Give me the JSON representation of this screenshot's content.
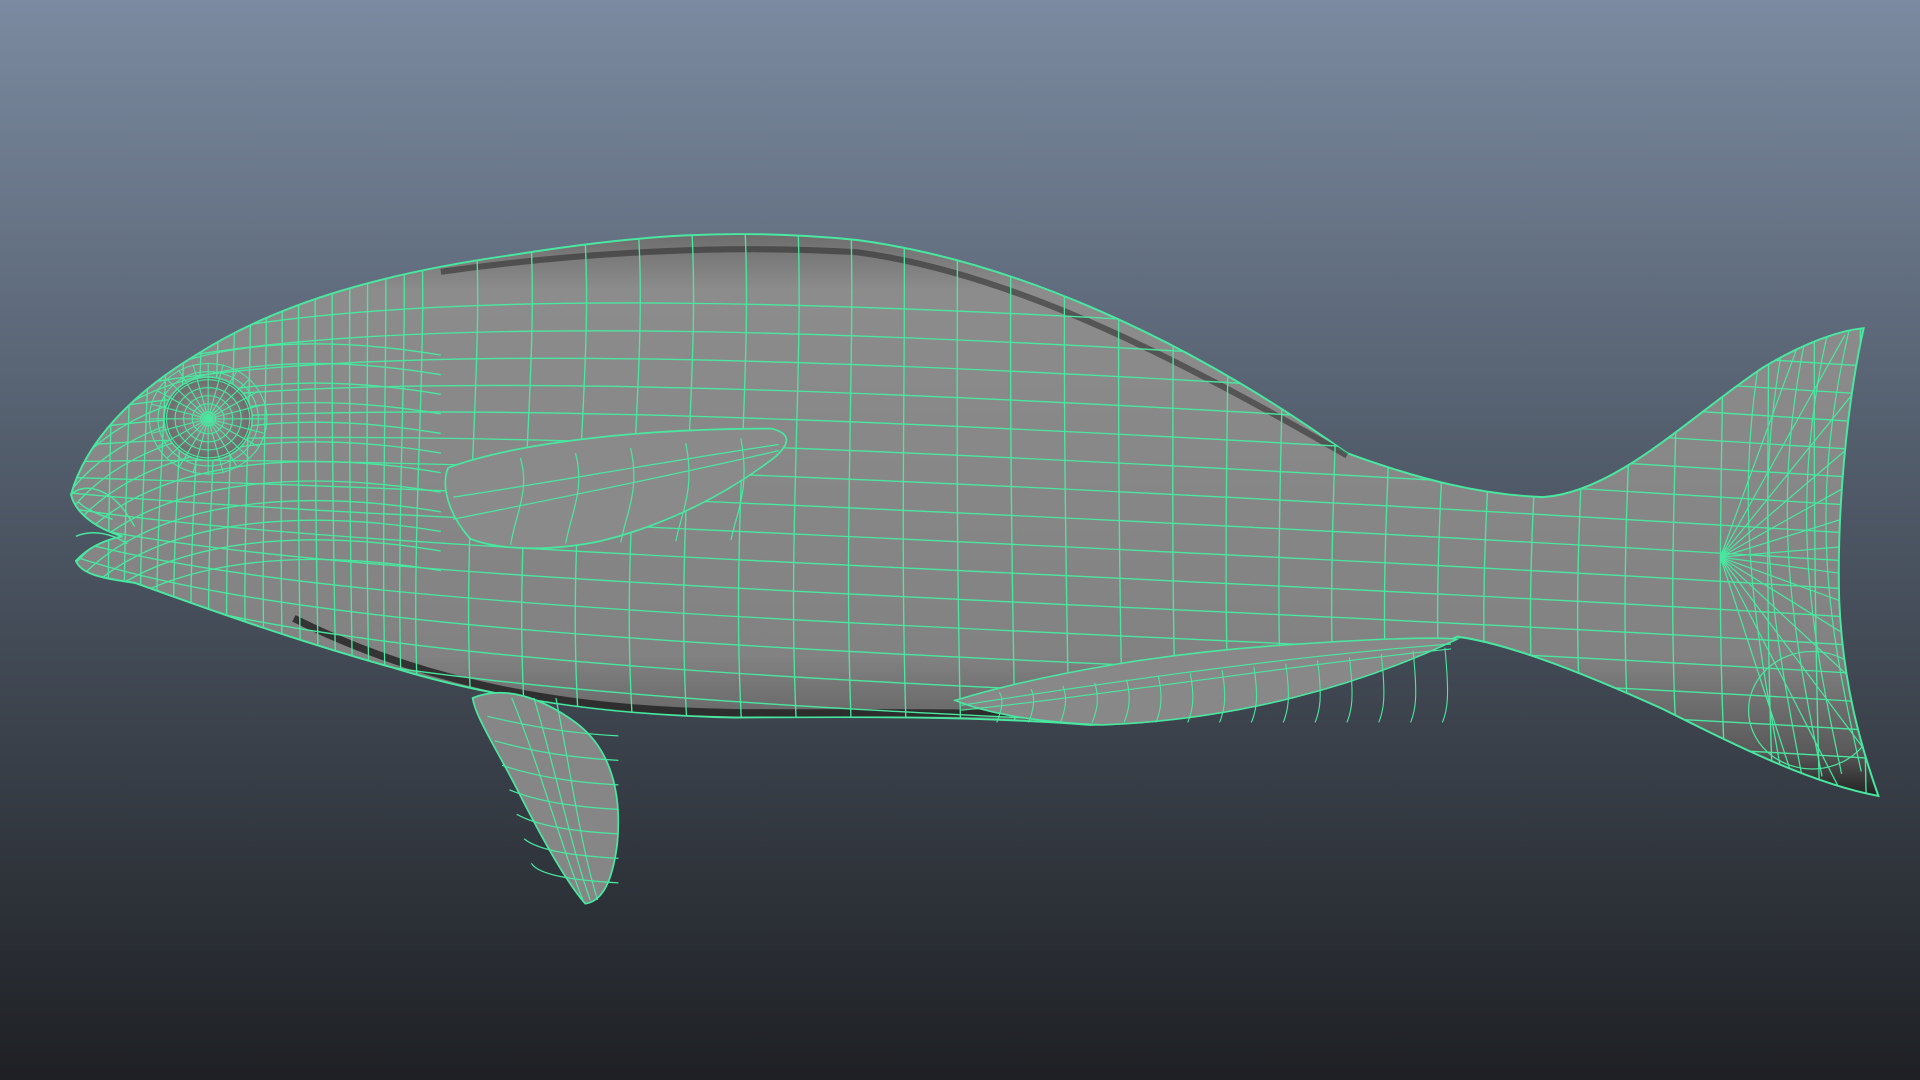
{
  "viewport": {
    "background_top": "#7b8aa0",
    "background_mid": "#545f6e",
    "background_bottom": "#1e2024"
  },
  "model": {
    "object": "fish-mesh",
    "display_mode": "wireframe-on-shaded",
    "selected": true,
    "wire_color": "#49e8a0",
    "shade_color": "#858585",
    "shade_light": "#a2a2a2",
    "shade_dark": "#2a2a2a",
    "parts": [
      "fish-body",
      "tail-fin",
      "pectoral-fin",
      "pelvic-fin",
      "anal-fin",
      "eye",
      "mouth"
    ]
  }
}
